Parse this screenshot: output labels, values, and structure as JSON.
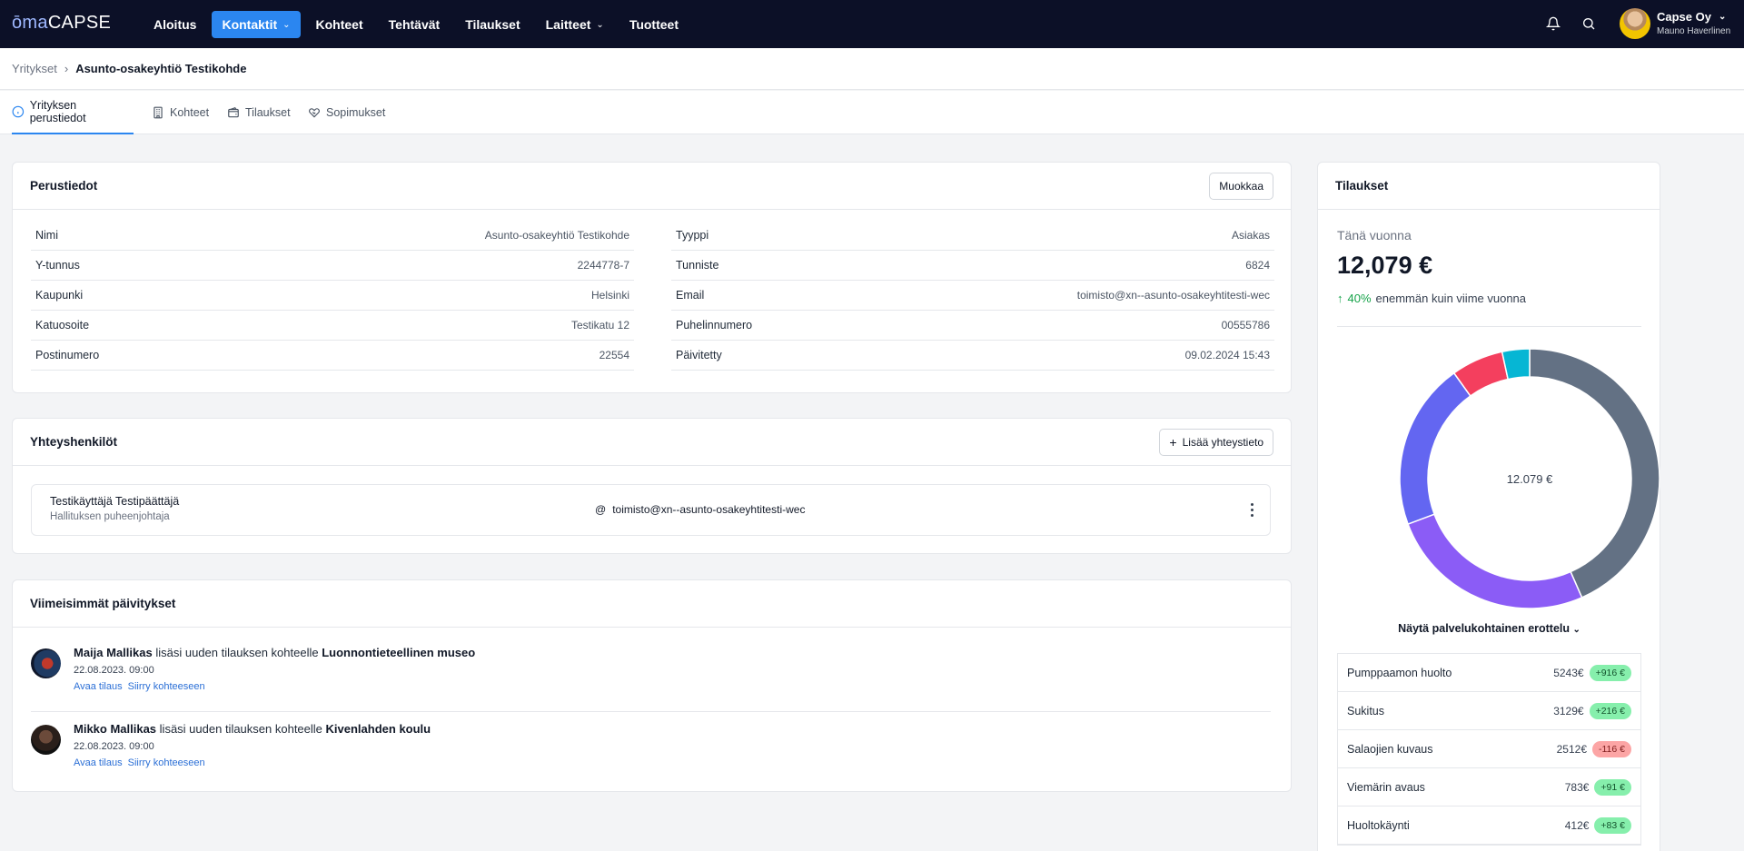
{
  "nav": {
    "logo_a": "ōma",
    "logo_b": "CAPSE",
    "items": [
      {
        "label": "Aloitus"
      },
      {
        "label": "Kontaktit",
        "chevron": "⌄"
      },
      {
        "label": "Kohteet"
      },
      {
        "label": "Tehtävät"
      },
      {
        "label": "Tilaukset"
      },
      {
        "label": "Laitteet",
        "chevron": "⌄"
      },
      {
        "label": "Tuotteet"
      }
    ],
    "user": {
      "company": "Capse Oy",
      "chevron": "⌄",
      "person": "Mauno Haverlinen"
    }
  },
  "breadcrumb": {
    "parent": "Yritykset",
    "separator": "›",
    "current": "Asunto-osakeyhtiö Testikohde"
  },
  "tabs": [
    {
      "label": "Yrityksen perustiedot",
      "icon": "info-icon"
    },
    {
      "label": "Kohteet",
      "icon": "building-icon"
    },
    {
      "label": "Tilaukset",
      "icon": "wallet-icon"
    },
    {
      "label": "Sopimukset",
      "icon": "handshake-icon"
    }
  ],
  "basic": {
    "title": "Perustiedot",
    "edit_label": "Muokkaa",
    "left": [
      {
        "label": "Nimi",
        "value": "Asunto-osakeyhtiö Testikohde"
      },
      {
        "label": "Y-tunnus",
        "value": "2244778-7"
      },
      {
        "label": "Kaupunki",
        "value": "Helsinki"
      },
      {
        "label": "Katuosoite",
        "value": "Testikatu 12"
      },
      {
        "label": "Postinumero",
        "value": "22554"
      }
    ],
    "right": [
      {
        "label": "Tyyppi",
        "value": "Asiakas"
      },
      {
        "label": "Tunniste",
        "value": "6824"
      },
      {
        "label": "Email",
        "value": "toimisto@xn--asunto-osakeyhtitesti-wec"
      },
      {
        "label": "Puhelinnumero",
        "value": "00555786"
      },
      {
        "label": "Päivitetty",
        "value": "09.02.2024 15:43"
      }
    ]
  },
  "contacts": {
    "title": "Yhteyshenkilöt",
    "add_label": "Lisää yhteystieto",
    "add_icon": "+",
    "items": [
      {
        "name": "Testikäyttäjä Testipäättäjä",
        "role": "Hallituksen puheenjohtaja",
        "email_icon": "@",
        "email": "toimisto@xn--asunto-osakeyhtitesti-wec"
      }
    ]
  },
  "updates": {
    "title": "Viimeisimmät päivitykset",
    "items": [
      {
        "user": "Maija Mallikas",
        "action": "lisäsi uuden tilauksen kohteelle",
        "target": "Luonnontieteellinen museo",
        "time": "22.08.2023. 09:00",
        "link1": "Avaa tilaus",
        "link2": "Siirry kohteeseen"
      },
      {
        "user": "Mikko Mallikas",
        "action": "lisäsi uuden tilauksen kohteelle",
        "target": "Kivenlahden koulu",
        "time": "22.08.2023. 09:00",
        "link1": "Avaa tilaus",
        "link2": "Siirry kohteeseen"
      }
    ]
  },
  "orders": {
    "title": "Tilaukset",
    "period_label": "Tänä vuonna",
    "total": "12,079 €",
    "growth_arrow": "↑",
    "growth_pct": "40%",
    "growth_text": "enemmän kuin viime vuonna",
    "center_label": "12.079 €",
    "breakdown_label": "Näytä palvelukohtainen erottelu",
    "breakdown_chevron": "⌄",
    "colors": {
      "pos_bg": "#86efac",
      "pos_fg": "#14532d",
      "neg_bg": "#fca5a5",
      "neg_fg": "#7f1d1d"
    },
    "services": [
      {
        "name": "Pumppaamon huolto",
        "amount": "5243€",
        "change": "+916 €",
        "positive": true
      },
      {
        "name": "Sukitus",
        "amount": "3129€",
        "change": "+216 €",
        "positive": true
      },
      {
        "name": "Salaojien kuvaus",
        "amount": "2512€",
        "change": "-116 €",
        "positive": false
      },
      {
        "name": "Viemärin avaus",
        "amount": "783€",
        "change": "+91 €",
        "positive": true
      },
      {
        "name": "Huoltokäynti",
        "amount": "412€",
        "change": "+83 €",
        "positive": true
      }
    ]
  },
  "chart_data": {
    "type": "pie",
    "categories": [
      "Pumppaamon huolto",
      "Sukitus",
      "Salaojien kuvaus",
      "Viemärin avaus",
      "Huoltokäynti"
    ],
    "values": [
      5243,
      3129,
      2512,
      783,
      412
    ],
    "colors": [
      "#637184",
      "#8b5cf6",
      "#6366f1",
      "#f43f5e",
      "#06b6d4"
    ],
    "title": "",
    "legend": "none"
  }
}
